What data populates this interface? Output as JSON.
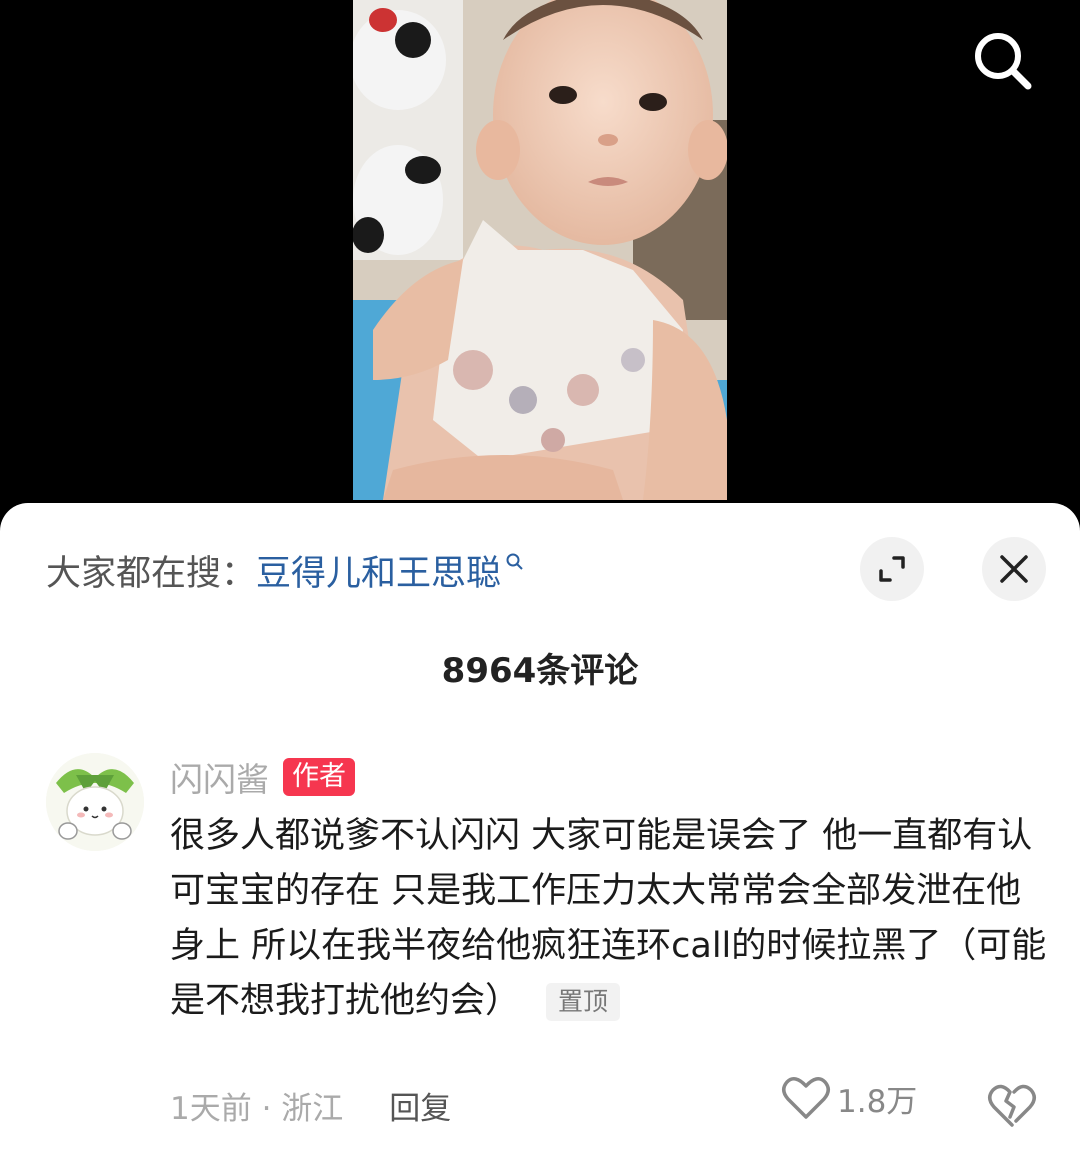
{
  "trending": {
    "prefix": "大家都在搜：",
    "query": "豆得儿和王思聪"
  },
  "comments_header": {
    "count_label": "8964条评论"
  },
  "comment": {
    "username": "闪闪酱",
    "badge": "作者",
    "text": "很多人都说爹不认闪闪 大家可能是误会了 他一直都有认可宝宝的存在 只是我工作压力太大常常会全部发泄在他身上 所以在我半夜给他疯狂连环call的时候拉黑了（可能是不想我打扰他约会）",
    "pinned_label": "置顶",
    "time_location": "1天前 · 浙江",
    "reply_label": "回复",
    "like_count": "1.8万"
  },
  "colors": {
    "link": "#2a5fa0",
    "badge": "#f6364f",
    "sheet_bg": "#ffffff"
  },
  "icons": [
    "search-icon",
    "magnifier-small-icon",
    "expand-icon",
    "close-icon",
    "heart-icon",
    "broken-heart-icon"
  ]
}
